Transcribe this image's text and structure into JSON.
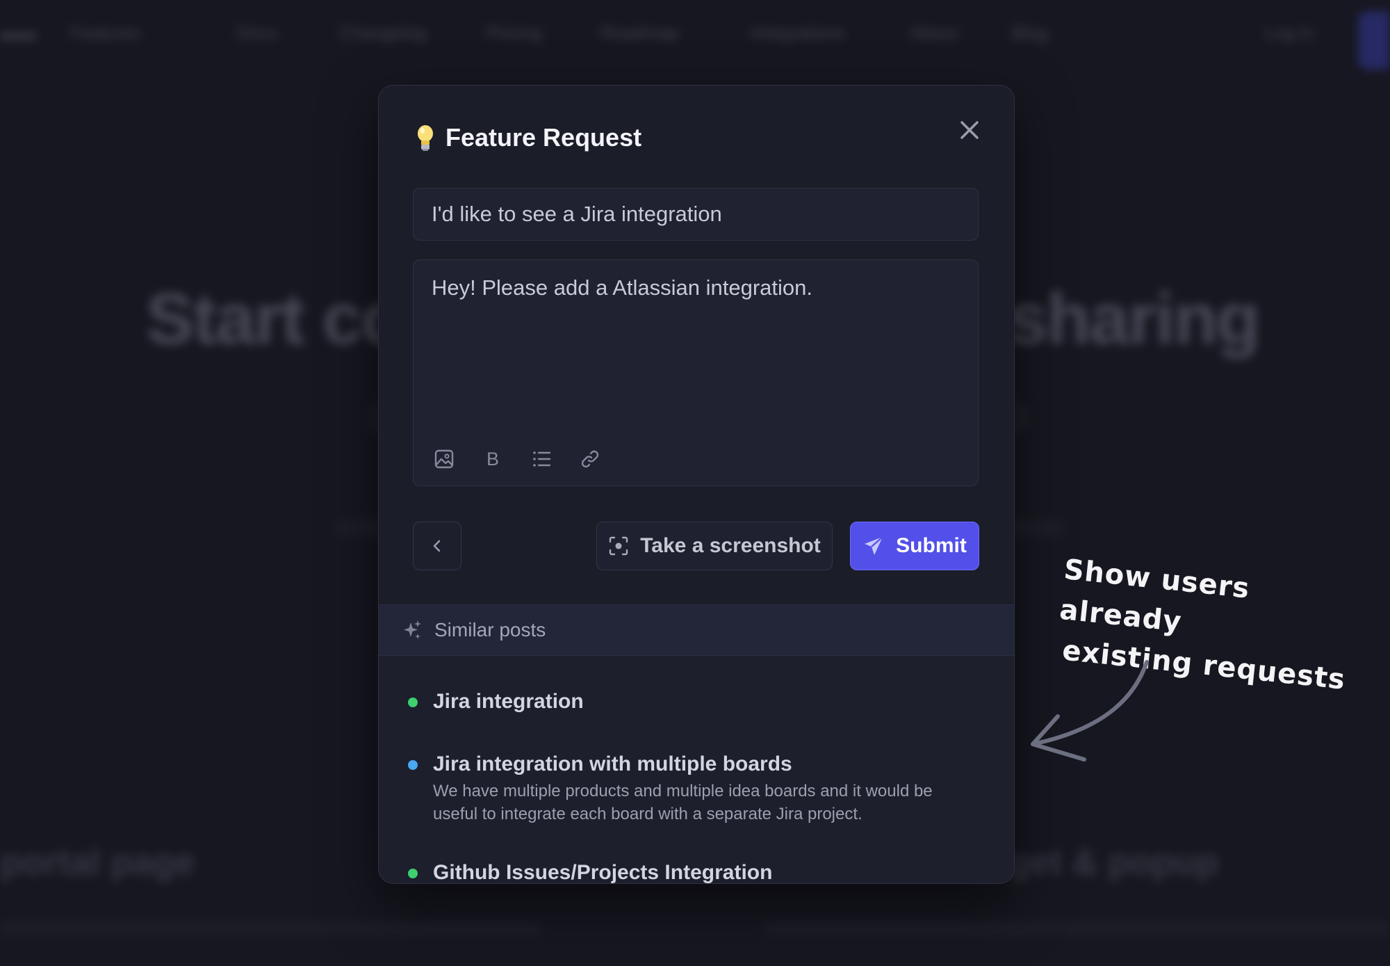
{
  "background": {
    "nav_items": [
      "Features",
      "Docs",
      "Changelog",
      "Pricing",
      "Roadmap",
      "Integrations",
      "About",
      "Blog"
    ],
    "nav_login": "Log in",
    "headline_left": "Start co",
    "headline_right": "sharing",
    "footer_left": "portal page",
    "footer_right": "get & popup"
  },
  "modal": {
    "title": "Feature Request",
    "title_input_value": "I'd like to see a Jira integration",
    "description_value": "Hey! Please add a Atlassian integration.",
    "toolbar": {
      "image_icon": "image-icon",
      "bold_label": "B",
      "list_icon": "list-icon",
      "link_icon": "link-icon"
    },
    "screenshot_label": "Take a screenshot",
    "submit_label": "Submit",
    "similar_label": "Similar posts",
    "posts": [
      {
        "title": "Jira integration",
        "description": "",
        "status_color": "#3ecf6e"
      },
      {
        "title": "Jira integration with multiple boards",
        "description": "We have multiple products and multiple idea boards and it would be useful to integrate each board with a separate Jira project.",
        "status_color": "#4aa8f0"
      },
      {
        "title": "Github Issues/Projects Integration",
        "description": "",
        "status_color": "#3ecf6e"
      }
    ]
  },
  "annotation": {
    "line1": "Show users already",
    "line2": "existing requests"
  },
  "colors": {
    "accent": "#5250e8",
    "background": "#1a1b25",
    "modal": "#1b1d29"
  }
}
